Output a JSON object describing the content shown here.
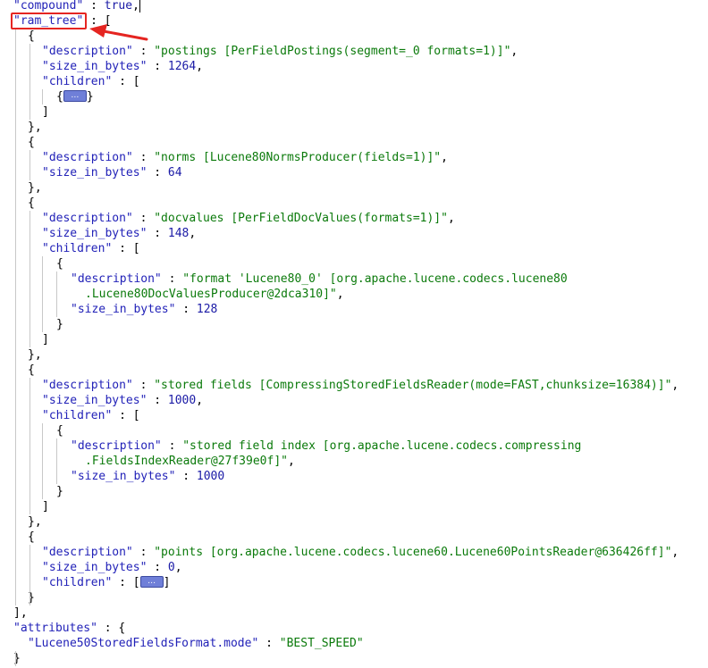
{
  "lines": [
    {
      "indent": 1,
      "parts": [
        [
          "k",
          "\"compound\""
        ],
        [
          "p",
          " : "
        ],
        [
          "b",
          "true"
        ],
        [
          "p",
          ","
        ]
      ]
    },
    {
      "indent": 1,
      "parts": [
        [
          "k",
          "\"ram_tree\""
        ],
        [
          "p",
          " : ["
        ]
      ]
    },
    {
      "indent": 2,
      "parts": [
        [
          "p",
          "{"
        ]
      ]
    },
    {
      "indent": 3,
      "parts": [
        [
          "k",
          "\"description\""
        ],
        [
          "p",
          " : "
        ],
        [
          "s",
          "\"postings [PerFieldPostings(segment=_0 formats=1)]\""
        ],
        [
          "p",
          ","
        ]
      ]
    },
    {
      "indent": 3,
      "parts": [
        [
          "k",
          "\"size_in_bytes\""
        ],
        [
          "p",
          " : "
        ],
        [
          "n",
          "1264"
        ],
        [
          "p",
          ","
        ]
      ]
    },
    {
      "indent": 3,
      "parts": [
        [
          "k",
          "\"children\""
        ],
        [
          "p",
          " : ["
        ]
      ]
    },
    {
      "indent": 4,
      "parts": [
        [
          "p",
          "{"
        ],
        [
          "collapsed",
          ""
        ],
        [
          "p",
          "}"
        ]
      ]
    },
    {
      "indent": 3,
      "parts": [
        [
          "p",
          "]"
        ]
      ]
    },
    {
      "indent": 2,
      "parts": [
        [
          "p",
          "},"
        ]
      ]
    },
    {
      "indent": 2,
      "parts": [
        [
          "p",
          "{"
        ]
      ]
    },
    {
      "indent": 3,
      "parts": [
        [
          "k",
          "\"description\""
        ],
        [
          "p",
          " : "
        ],
        [
          "s",
          "\"norms [Lucene80NormsProducer(fields=1)]\""
        ],
        [
          "p",
          ","
        ]
      ]
    },
    {
      "indent": 3,
      "parts": [
        [
          "k",
          "\"size_in_bytes\""
        ],
        [
          "p",
          " : "
        ],
        [
          "n",
          "64"
        ]
      ]
    },
    {
      "indent": 2,
      "parts": [
        [
          "p",
          "},"
        ]
      ]
    },
    {
      "indent": 2,
      "parts": [
        [
          "p",
          "{"
        ]
      ]
    },
    {
      "indent": 3,
      "parts": [
        [
          "k",
          "\"description\""
        ],
        [
          "p",
          " : "
        ],
        [
          "s",
          "\"docvalues [PerFieldDocValues(formats=1)]\""
        ],
        [
          "p",
          ","
        ]
      ]
    },
    {
      "indent": 3,
      "parts": [
        [
          "k",
          "\"size_in_bytes\""
        ],
        [
          "p",
          " : "
        ],
        [
          "n",
          "148"
        ],
        [
          "p",
          ","
        ]
      ]
    },
    {
      "indent": 3,
      "parts": [
        [
          "k",
          "\"children\""
        ],
        [
          "p",
          " : ["
        ]
      ]
    },
    {
      "indent": 4,
      "parts": [
        [
          "p",
          "{"
        ]
      ]
    },
    {
      "indent": 5,
      "parts": [
        [
          "k",
          "\"description\""
        ],
        [
          "p",
          " : "
        ],
        [
          "s",
          "\"format 'Lucene80_0' [org.apache.lucene.codecs.lucene80"
        ]
      ]
    },
    {
      "indent": 6,
      "parts": [
        [
          "s",
          ".Lucene80DocValuesProducer@2dca310]\""
        ],
        [
          "p",
          ","
        ]
      ]
    },
    {
      "indent": 5,
      "parts": [
        [
          "k",
          "\"size_in_bytes\""
        ],
        [
          "p",
          " : "
        ],
        [
          "n",
          "128"
        ]
      ]
    },
    {
      "indent": 4,
      "parts": [
        [
          "p",
          "}"
        ]
      ]
    },
    {
      "indent": 3,
      "parts": [
        [
          "p",
          "]"
        ]
      ]
    },
    {
      "indent": 2,
      "parts": [
        [
          "p",
          "},"
        ]
      ]
    },
    {
      "indent": 2,
      "parts": [
        [
          "p",
          "{"
        ]
      ]
    },
    {
      "indent": 3,
      "parts": [
        [
          "k",
          "\"description\""
        ],
        [
          "p",
          " : "
        ],
        [
          "s",
          "\"stored fields [CompressingStoredFieldsReader(mode=FAST,chunksize=16384)]\""
        ],
        [
          "p",
          ","
        ]
      ]
    },
    {
      "indent": 3,
      "parts": [
        [
          "k",
          "\"size_in_bytes\""
        ],
        [
          "p",
          " : "
        ],
        [
          "n",
          "1000"
        ],
        [
          "p",
          ","
        ]
      ]
    },
    {
      "indent": 3,
      "parts": [
        [
          "k",
          "\"children\""
        ],
        [
          "p",
          " : ["
        ]
      ]
    },
    {
      "indent": 4,
      "parts": [
        [
          "p",
          "{"
        ]
      ]
    },
    {
      "indent": 5,
      "parts": [
        [
          "k",
          "\"description\""
        ],
        [
          "p",
          " : "
        ],
        [
          "s",
          "\"stored field index [org.apache.lucene.codecs.compressing"
        ]
      ]
    },
    {
      "indent": 6,
      "parts": [
        [
          "s",
          ".FieldsIndexReader@27f39e0f]\""
        ],
        [
          "p",
          ","
        ]
      ]
    },
    {
      "indent": 5,
      "parts": [
        [
          "k",
          "\"size_in_bytes\""
        ],
        [
          "p",
          " : "
        ],
        [
          "n",
          "1000"
        ]
      ]
    },
    {
      "indent": 4,
      "parts": [
        [
          "p",
          "}"
        ]
      ]
    },
    {
      "indent": 3,
      "parts": [
        [
          "p",
          "]"
        ]
      ]
    },
    {
      "indent": 2,
      "parts": [
        [
          "p",
          "},"
        ]
      ]
    },
    {
      "indent": 2,
      "parts": [
        [
          "p",
          "{"
        ]
      ]
    },
    {
      "indent": 3,
      "parts": [
        [
          "k",
          "\"description\""
        ],
        [
          "p",
          " : "
        ],
        [
          "s",
          "\"points [org.apache.lucene.codecs.lucene60.Lucene60PointsReader@636426ff]\""
        ],
        [
          "p",
          ","
        ]
      ]
    },
    {
      "indent": 3,
      "parts": [
        [
          "k",
          "\"size_in_bytes\""
        ],
        [
          "p",
          " : "
        ],
        [
          "n",
          "0"
        ],
        [
          "p",
          ","
        ]
      ]
    },
    {
      "indent": 3,
      "parts": [
        [
          "k",
          "\"children\""
        ],
        [
          "p",
          " : ["
        ],
        [
          "collapsed",
          ""
        ],
        [
          "p",
          "]"
        ]
      ]
    },
    {
      "indent": 2,
      "parts": [
        [
          "p",
          "}"
        ]
      ]
    },
    {
      "indent": 1,
      "parts": [
        [
          "p",
          "],"
        ]
      ]
    },
    {
      "indent": 1,
      "parts": [
        [
          "k",
          "\"attributes\""
        ],
        [
          "p",
          " : {"
        ]
      ]
    },
    {
      "indent": 2,
      "parts": [
        [
          "k",
          "\"Lucene50StoredFieldsFormat.mode\""
        ],
        [
          "p",
          " : "
        ],
        [
          "s",
          "\"BEST_SPEED\""
        ]
      ]
    },
    {
      "indent": 1,
      "parts": [
        [
          "p",
          "}"
        ]
      ]
    }
  ],
  "collapsed_glyph": "…",
  "annotation": {
    "box_color": "#e52521",
    "highlighted_key": "ram_tree"
  }
}
